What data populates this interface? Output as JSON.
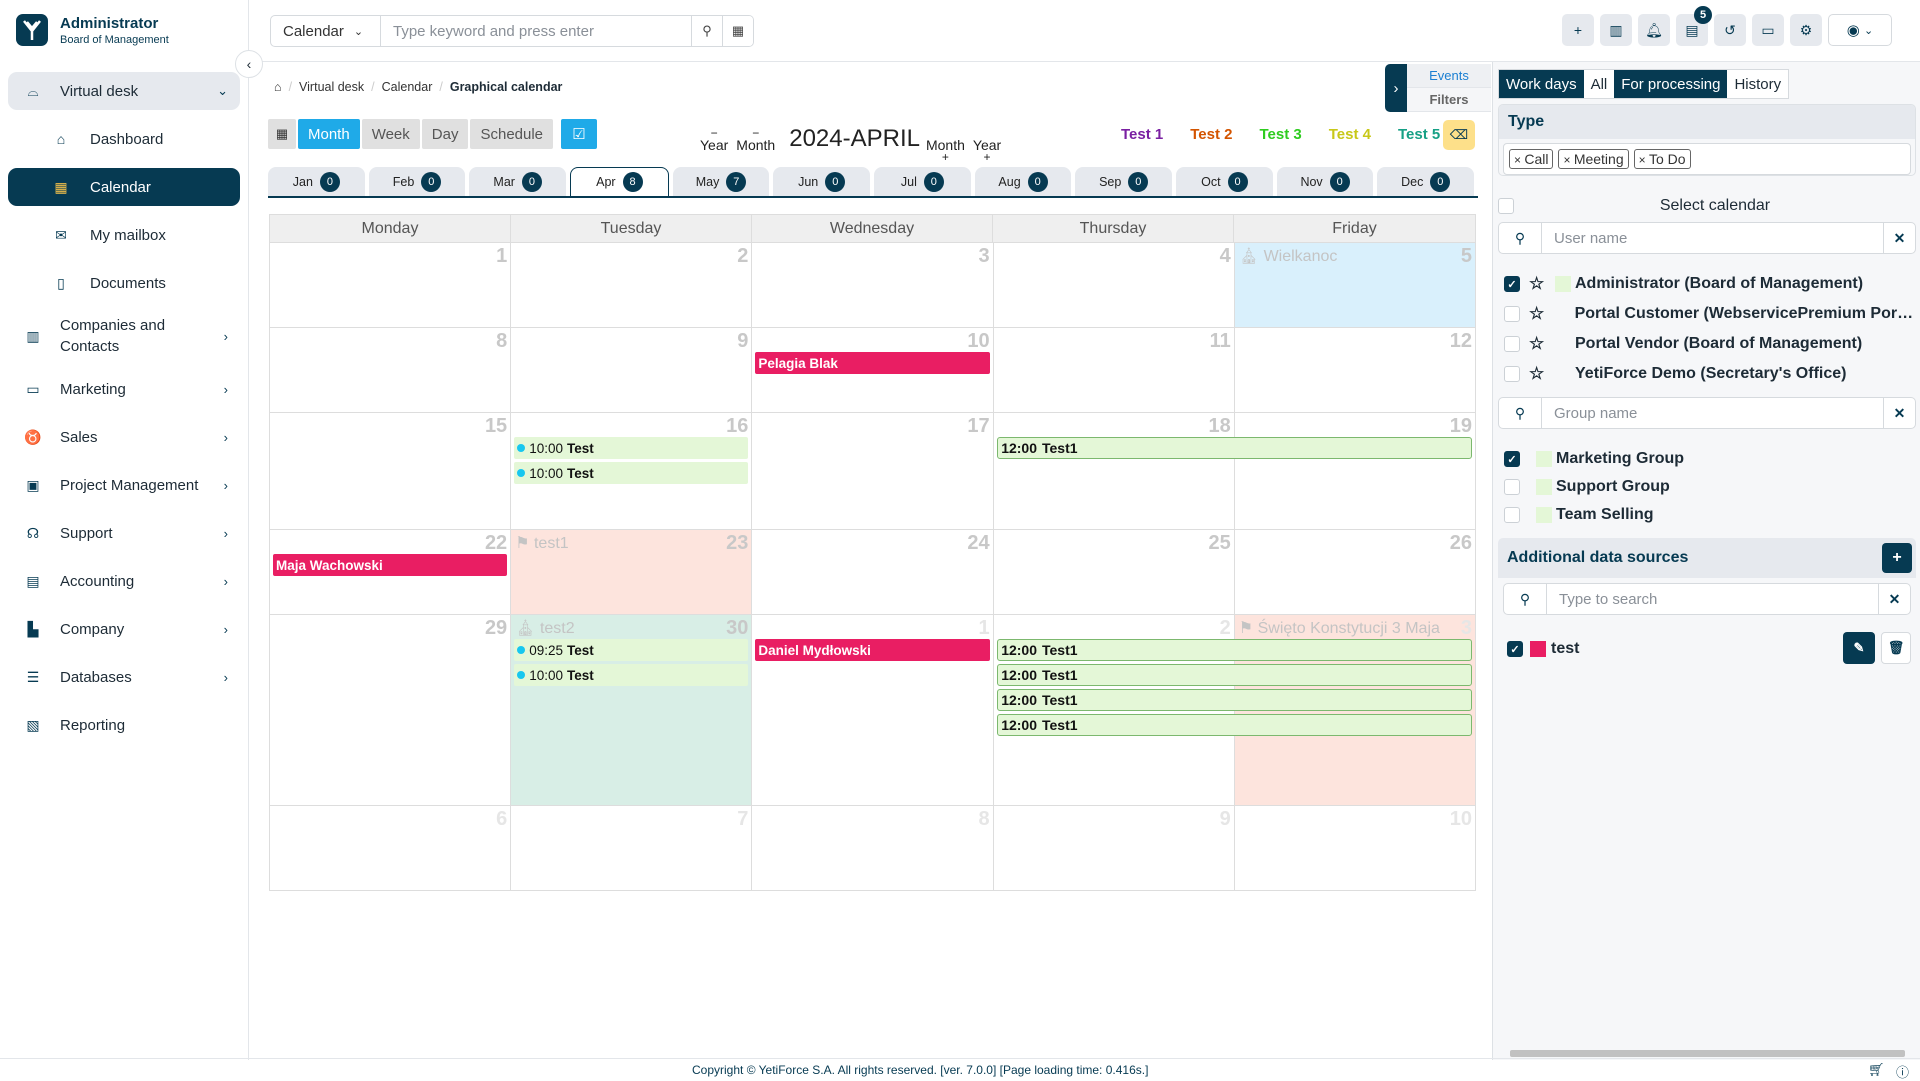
{
  "brand": {
    "name": "Administrator",
    "subtitle": "Board of Management"
  },
  "sidebar": {
    "items": [
      {
        "label": "Virtual desk",
        "icon": "desk-icon",
        "state": "open"
      },
      {
        "label": "Dashboard",
        "icon": "home-icon",
        "sub": true
      },
      {
        "label": "Calendar",
        "icon": "calendar-icon",
        "sub": true,
        "active": true
      },
      {
        "label": "My mailbox",
        "icon": "mail-icon",
        "sub": true
      },
      {
        "label": "Documents",
        "icon": "document-icon",
        "sub": true
      },
      {
        "label": "Companies and Contacts",
        "icon": "building-icon"
      },
      {
        "label": "Marketing",
        "icon": "chat-icon"
      },
      {
        "label": "Sales",
        "icon": "piggy-bank-icon"
      },
      {
        "label": "Project Management",
        "icon": "briefcase-icon"
      },
      {
        "label": "Support",
        "icon": "headphones-icon"
      },
      {
        "label": "Accounting",
        "icon": "receipt-icon"
      },
      {
        "label": "Company",
        "icon": "office-icon"
      },
      {
        "label": "Databases",
        "icon": "database-icon"
      },
      {
        "label": "Reporting",
        "icon": "report-icon"
      }
    ]
  },
  "topbar": {
    "module_select": "Calendar",
    "search_placeholder": "Type keyword and press enter",
    "notification_badge": "5"
  },
  "breadcrumb": {
    "items": [
      "Virtual desk",
      "Calendar"
    ],
    "current": "Graphical calendar"
  },
  "views": {
    "month": "Month",
    "week": "Week",
    "day": "Day",
    "schedule": "Schedule",
    "active": "Month"
  },
  "date_nav": {
    "prev_year": "Year",
    "prev_month": "Month",
    "title": "2024-APRIL",
    "next_month": "Month",
    "next_year": "Year",
    "minus": "−",
    "plus": "+"
  },
  "legend": [
    {
      "label": "Test 1",
      "color": "#7a1fa2"
    },
    {
      "label": "Test 2",
      "color": "#d35400"
    },
    {
      "label": "Test 3",
      "color": "#2ecc1f"
    },
    {
      "label": "Test 4",
      "color": "#c8c819"
    },
    {
      "label": "Test 5",
      "color": "#16a085"
    }
  ],
  "month_tabs": [
    {
      "label": "Jan",
      "count": "0"
    },
    {
      "label": "Feb",
      "count": "0"
    },
    {
      "label": "Mar",
      "count": "0"
    },
    {
      "label": "Apr",
      "count": "8",
      "active": true
    },
    {
      "label": "May",
      "count": "7"
    },
    {
      "label": "Jun",
      "count": "0"
    },
    {
      "label": "Jul",
      "count": "0"
    },
    {
      "label": "Aug",
      "count": "0"
    },
    {
      "label": "Sep",
      "count": "0"
    },
    {
      "label": "Oct",
      "count": "0"
    },
    {
      "label": "Nov",
      "count": "0"
    },
    {
      "label": "Dec",
      "count": "0"
    }
  ],
  "calendar": {
    "weekdays": [
      "Monday",
      "Tuesday",
      "Wednesday",
      "Thursday",
      "Friday"
    ],
    "weeks": [
      {
        "days": [
          {
            "num": "1"
          },
          {
            "num": "2"
          },
          {
            "num": "3"
          },
          {
            "num": "4"
          },
          {
            "num": "5",
            "bg": "#d9f0fc",
            "holiday": "Wielkanoc",
            "holiday_icon": "church-icon"
          }
        ]
      },
      {
        "days": [
          {
            "num": "8"
          },
          {
            "num": "9"
          },
          {
            "num": "10",
            "events": [
              {
                "type": "pink",
                "title": "Pelagia Blak"
              }
            ]
          },
          {
            "num": "11"
          },
          {
            "num": "12"
          }
        ]
      },
      {
        "days": [
          {
            "num": "15"
          },
          {
            "num": "16",
            "events": [
              {
                "type": "green",
                "time": "10:00",
                "title": "Test"
              },
              {
                "type": "green",
                "time": "10:00",
                "title": "Test"
              }
            ]
          },
          {
            "num": "17"
          },
          {
            "num": "18"
          },
          {
            "num": "19"
          }
        ],
        "spans": [
          {
            "start": 3,
            "end": 4,
            "row": 0,
            "time": "12:00",
            "title": "Test1"
          }
        ]
      },
      {
        "days": [
          {
            "num": "22",
            "events": [
              {
                "type": "pink",
                "title": "Maja Wachowski"
              }
            ]
          },
          {
            "num": "23",
            "bg": "#fde4dd",
            "holiday": "test1",
            "holiday_icon": "flag-icon"
          },
          {
            "num": "24"
          },
          {
            "num": "25"
          },
          {
            "num": "26"
          }
        ]
      },
      {
        "days": [
          {
            "num": "29"
          },
          {
            "num": "30",
            "bg": "#d8eee6",
            "holiday": "test2",
            "holiday_icon": "church-icon",
            "events": [
              {
                "type": "green",
                "time": "09:25",
                "title": "Test"
              },
              {
                "type": "green",
                "time": "10:00",
                "title": "Test"
              }
            ]
          },
          {
            "num": "1",
            "other": true,
            "events": [
              {
                "type": "pink",
                "title": "Daniel Mydłowski"
              }
            ]
          },
          {
            "num": "2",
            "other": true
          },
          {
            "num": "3",
            "other": true,
            "bg": "#fde4dd",
            "holiday": "Święto Konstytucji 3 Maja",
            "holiday_icon": "flag-icon"
          }
        ],
        "spans": [
          {
            "start": 3,
            "end": 4,
            "row": 0,
            "time": "12:00",
            "title": "Test1"
          },
          {
            "start": 3,
            "end": 4,
            "row": 1,
            "time": "12:00",
            "title": "Test1"
          },
          {
            "start": 3,
            "end": 4,
            "row": 2,
            "time": "12:00",
            "title": "Test1"
          },
          {
            "start": 3,
            "end": 4,
            "row": 3,
            "time": "12:00",
            "title": "Test1"
          }
        ]
      },
      {
        "days": [
          {
            "num": "6",
            "other": true
          },
          {
            "num": "7",
            "other": true
          },
          {
            "num": "8",
            "other": true
          },
          {
            "num": "9",
            "other": true
          },
          {
            "num": "10",
            "other": true
          }
        ]
      }
    ]
  },
  "right_tabs": {
    "events": "Events",
    "filters": "Filters"
  },
  "right_panel": {
    "toggles": [
      {
        "label": "Work days",
        "on": true
      },
      {
        "label": "All",
        "on": false
      },
      {
        "label": "For processing",
        "on": true
      },
      {
        "label": "History",
        "on": false
      }
    ],
    "type_title": "Type",
    "type_chips": [
      "Call",
      "Meeting",
      "To Do"
    ],
    "select_calendar": "Select calendar",
    "user_search_placeholder": "User name",
    "users": [
      {
        "name": "Administrator (Board of Management)",
        "checked": true,
        "color": "#e4f7d7"
      },
      {
        "name": "Portal Customer (WebservicePremium Portal)",
        "checked": false
      },
      {
        "name": "Portal Vendor (Board of Management)",
        "checked": false
      },
      {
        "name": "YetiForce Demo (Secretary's Office)",
        "checked": false
      }
    ],
    "group_search_placeholder": "Group name",
    "groups": [
      {
        "name": "Marketing Group",
        "checked": true
      },
      {
        "name": "Support Group",
        "checked": false
      },
      {
        "name": "Team Selling",
        "checked": false
      }
    ],
    "additional_title": "Additional data sources",
    "additional_search_placeholder": "Type to search",
    "sources": [
      {
        "name": "test",
        "checked": true,
        "color": "#e91e63"
      }
    ]
  },
  "footer": {
    "copyright": "Copyright © YetiForce S.A. All rights reserved. [ver. 7.0.0] [Page loading time: 0.416s.]"
  }
}
